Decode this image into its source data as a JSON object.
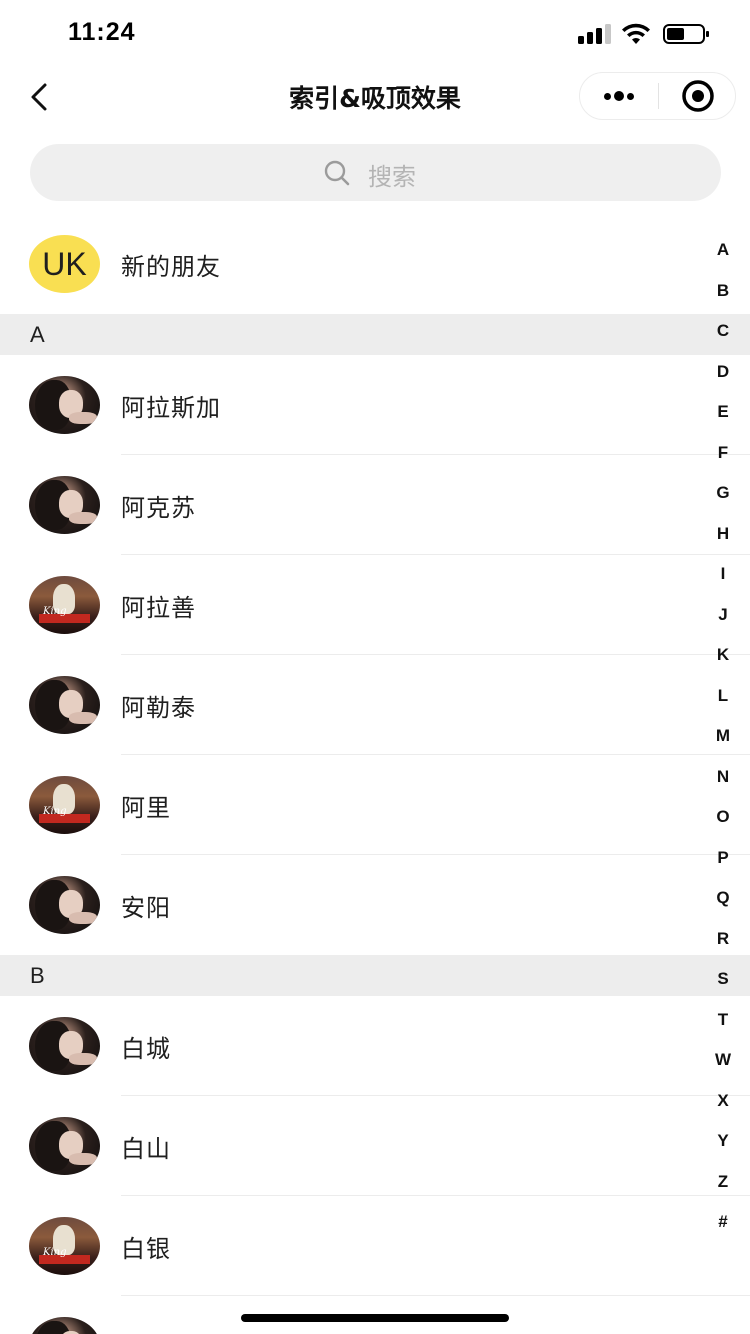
{
  "status_bar": {
    "time": "11:24"
  },
  "nav": {
    "title": "索引&吸顶效果"
  },
  "search": {
    "placeholder": "搜索"
  },
  "new_friends": {
    "avatar_text": "UK",
    "label": "新的朋友"
  },
  "sections": [
    {
      "letter": "A",
      "contacts": [
        {
          "name": "阿拉斯加",
          "avatar": "portrait"
        },
        {
          "name": "阿克苏",
          "avatar": "portrait"
        },
        {
          "name": "阿拉善",
          "avatar": "poster"
        },
        {
          "name": "阿勒泰",
          "avatar": "portrait"
        },
        {
          "name": "阿里",
          "avatar": "poster"
        },
        {
          "name": "安阳",
          "avatar": "portrait"
        }
      ]
    },
    {
      "letter": "B",
      "contacts": [
        {
          "name": "白城",
          "avatar": "portrait"
        },
        {
          "name": "白山",
          "avatar": "portrait"
        },
        {
          "name": "白银",
          "avatar": "poster"
        },
        {
          "name": "",
          "avatar": "portrait"
        }
      ]
    }
  ],
  "index_letters": [
    "A",
    "B",
    "C",
    "D",
    "E",
    "F",
    "G",
    "H",
    "I",
    "J",
    "K",
    "L",
    "M",
    "N",
    "O",
    "P",
    "Q",
    "R",
    "S",
    "T",
    "W",
    "X",
    "Y",
    "Z",
    "#"
  ],
  "colors": {
    "accent_avatar": "#f9df52",
    "section_bg": "#ededed",
    "search_bg": "#efefef"
  },
  "icons": [
    "back-icon",
    "more-icon",
    "record-icon",
    "search-icon",
    "signal-icon",
    "wifi-icon",
    "battery-icon"
  ]
}
